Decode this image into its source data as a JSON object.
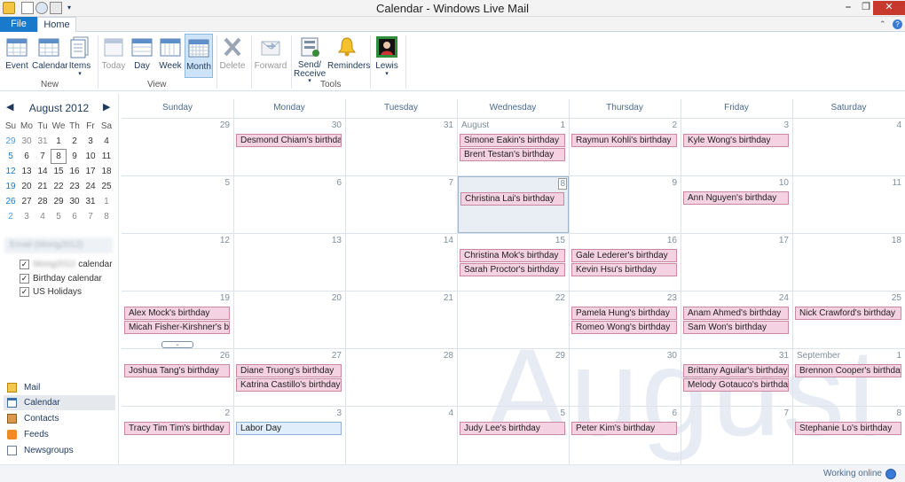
{
  "window": {
    "title": "Calendar - Windows Live Mail",
    "minimize_label": "⎯",
    "restore_label": "❐",
    "close_label": "✕"
  },
  "tabs": [
    {
      "label": "File"
    },
    {
      "label": "Home"
    }
  ],
  "ribbon": {
    "buttons": [
      {
        "label": "Event",
        "icon": "event-icon",
        "disabled": false
      },
      {
        "label": "Calendar",
        "icon": "calendar-icon",
        "disabled": false
      },
      {
        "label": "Items",
        "icon": "items-icon",
        "disabled": false
      },
      {
        "label": "Today",
        "icon": "today-icon",
        "disabled": true
      },
      {
        "label": "Day",
        "icon": "day-view-icon",
        "disabled": false
      },
      {
        "label": "Week",
        "icon": "week-view-icon",
        "disabled": false
      },
      {
        "label": "Month",
        "icon": "month-view-icon",
        "disabled": false,
        "selected": true
      },
      {
        "label": "Delete",
        "icon": "delete-icon",
        "disabled": true
      },
      {
        "label": "Forward",
        "icon": "forward-icon",
        "disabled": true
      },
      {
        "label": "Send/ Receive",
        "icon": "send-receive-icon",
        "disabled": false
      },
      {
        "label": "Reminders",
        "icon": "reminders-icon",
        "disabled": false
      },
      {
        "label": "Lewis",
        "icon": "user-avatar-icon",
        "disabled": false
      }
    ],
    "groups": [
      "New",
      "View",
      "Tools"
    ]
  },
  "mini_calendar": {
    "title": "August 2012",
    "prev": "◀",
    "next": "▶",
    "weekday_headers": [
      "Su",
      "Mo",
      "Tu",
      "We",
      "Th",
      "Fr",
      "Sa"
    ],
    "weeks": [
      [
        "29",
        "30",
        "31",
        "1",
        "2",
        "3",
        "4"
      ],
      [
        "5",
        "6",
        "7",
        "8",
        "9",
        "10",
        "11"
      ],
      [
        "12",
        "13",
        "14",
        "15",
        "16",
        "17",
        "18"
      ],
      [
        "19",
        "20",
        "21",
        "22",
        "23",
        "24",
        "25"
      ],
      [
        "26",
        "27",
        "28",
        "29",
        "30",
        "31",
        "1"
      ],
      [
        "2",
        "3",
        "4",
        "5",
        "6",
        "7",
        "8"
      ]
    ],
    "today": "8"
  },
  "calendars": {
    "account": "Email (Wong2012)",
    "items": [
      {
        "label": "calendar",
        "checked": true,
        "color": "#5a9bd8"
      },
      {
        "label": "Birthday calendar",
        "checked": true,
        "color": "#d86a8f"
      },
      {
        "label": "US Holidays",
        "checked": true,
        "color": "#7fb0dd"
      }
    ]
  },
  "nav": [
    {
      "label": "Mail",
      "icon": "mail-icon"
    },
    {
      "label": "Calendar",
      "icon": "calendar-nav-icon",
      "selected": true
    },
    {
      "label": "Contacts",
      "icon": "contacts-icon"
    },
    {
      "label": "Feeds",
      "icon": "feeds-icon"
    },
    {
      "label": "Newsgroups",
      "icon": "newsgroups-icon"
    }
  ],
  "month_view": {
    "watermark": "August",
    "weekdays": [
      "Sunday",
      "Monday",
      "Tuesday",
      "Wednesday",
      "Thursday",
      "Friday",
      "Saturday"
    ],
    "weeks": [
      [
        {
          "day": "29",
          "events": []
        },
        {
          "day": "30",
          "events": [
            "Desmond Chiam's birthday"
          ]
        },
        {
          "day": "31",
          "events": []
        },
        {
          "day": "1",
          "month": "August",
          "events": [
            "Simone Eakin's birthday",
            "Brent Testan's birthday"
          ]
        },
        {
          "day": "2",
          "events": [
            "Raymun Kohli's birthday"
          ]
        },
        {
          "day": "3",
          "events": [
            "Kyle Wong's birthday"
          ]
        },
        {
          "day": "4",
          "events": []
        }
      ],
      [
        {
          "day": "5",
          "events": []
        },
        {
          "day": "6",
          "events": []
        },
        {
          "day": "7",
          "events": []
        },
        {
          "day": "8",
          "today": true,
          "events": [
            "Christina Lai's birthday"
          ]
        },
        {
          "day": "9",
          "events": []
        },
        {
          "day": "10",
          "events": [
            "Ann Nguyen's birthday"
          ]
        },
        {
          "day": "11",
          "events": []
        }
      ],
      [
        {
          "day": "12",
          "events": []
        },
        {
          "day": "13",
          "events": []
        },
        {
          "day": "14",
          "events": []
        },
        {
          "day": "15",
          "events": [
            "Christina Mok's birthday",
            "Sarah Proctor's birthday"
          ]
        },
        {
          "day": "16",
          "events": [
            "Gale Lederer's birthday",
            "Kevin Hsu's birthday"
          ]
        },
        {
          "day": "17",
          "events": []
        },
        {
          "day": "18",
          "events": []
        }
      ],
      [
        {
          "day": "19",
          "events": [
            "Alex Mock's birthday",
            "Micah Fisher-Kirshner's birt"
          ],
          "more": true
        },
        {
          "day": "20",
          "events": []
        },
        {
          "day": "21",
          "events": []
        },
        {
          "day": "22",
          "events": []
        },
        {
          "day": "23",
          "events": [
            "Pamela Hung's birthday",
            "Romeo Wong's birthday"
          ]
        },
        {
          "day": "24",
          "events": [
            "Anam Ahmed's birthday",
            "Sam Won's birthday"
          ]
        },
        {
          "day": "25",
          "events": [
            "Nick Crawford's birthday"
          ]
        }
      ],
      [
        {
          "day": "26",
          "events": [
            "Joshua Tang's birthday"
          ]
        },
        {
          "day": "27",
          "events": [
            "Diane Truong's birthday",
            "Katrina Castillo's birthday"
          ]
        },
        {
          "day": "28",
          "events": []
        },
        {
          "day": "29",
          "events": []
        },
        {
          "day": "30",
          "events": []
        },
        {
          "day": "31",
          "events": [
            "Brittany Aguilar's birthday",
            "Melody Gotauco's birthday"
          ]
        },
        {
          "day": "1",
          "month": "September",
          "events": [
            "Brennon Cooper's birthday"
          ]
        }
      ],
      [
        {
          "day": "2",
          "events": [
            "Tracy Tim Tim's birthday"
          ]
        },
        {
          "day": "3",
          "holiday": true,
          "events": [
            "Labor Day"
          ]
        },
        {
          "day": "4",
          "events": []
        },
        {
          "day": "5",
          "events": [
            "Judy Lee's birthday"
          ]
        },
        {
          "day": "6",
          "events": [
            "Peter Kim's birthday"
          ]
        },
        {
          "day": "7",
          "events": []
        },
        {
          "day": "8",
          "events": [
            "Stephanie Lo's birthday"
          ]
        }
      ]
    ]
  },
  "status": {
    "text": "Working online"
  }
}
